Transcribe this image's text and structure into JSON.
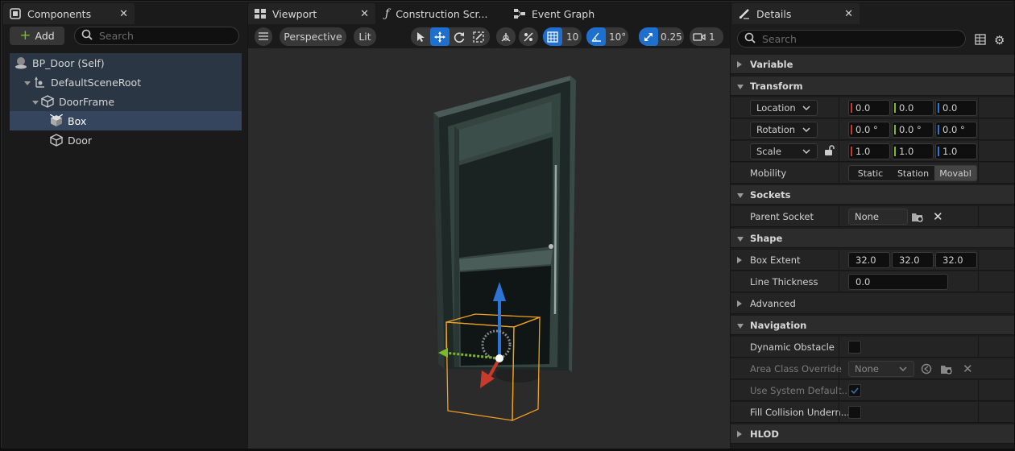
{
  "components_panel": {
    "tab_label": "Components",
    "add_label": "Add",
    "search_placeholder": "Search",
    "tree": [
      {
        "label": "BP_Door (Self)",
        "icon": "actor-icon"
      },
      {
        "label": "DefaultSceneRoot",
        "icon": "scene-root-icon"
      },
      {
        "label": "DoorFrame",
        "icon": "static-mesh-icon"
      },
      {
        "label": "Box",
        "icon": "box-collision-icon",
        "selected": true
      },
      {
        "label": "Door",
        "icon": "static-mesh-icon"
      }
    ]
  },
  "viewport": {
    "tabs": [
      {
        "label": "Viewport",
        "icon": "viewport-icon"
      },
      {
        "label": "Construction Scr...",
        "icon": "function-icon"
      },
      {
        "label": "Event Graph",
        "icon": "graph-icon"
      }
    ],
    "toolbar": {
      "perspective_label": "Perspective",
      "lit_label": "Lit",
      "grid_snap": "10",
      "rotation_snap": "10°",
      "scale_snap": "0.25",
      "camera_speed": "1"
    }
  },
  "details": {
    "tab_label": "Details",
    "search_placeholder": "Search",
    "sections": {
      "variable": "Variable",
      "transform": "Transform",
      "sockets": "Sockets",
      "shape": "Shape",
      "advanced": "Advanced",
      "navigation": "Navigation",
      "hlod": "HLOD"
    },
    "transform": {
      "location": {
        "label": "Location",
        "x": "0.0",
        "y": "0.0",
        "z": "0.0"
      },
      "rotation": {
        "label": "Rotation",
        "x": "0.0 °",
        "y": "0.0 °",
        "z": "0.0 °"
      },
      "scale": {
        "label": "Scale",
        "x": "1.0",
        "y": "1.0",
        "z": "1.0"
      },
      "mobility": {
        "label": "Mobility",
        "options": [
          "Static",
          "Station",
          "Movabl"
        ],
        "selected": "Movabl"
      }
    },
    "sockets": {
      "parent_socket_label": "Parent Socket",
      "parent_socket_value": "None"
    },
    "shape": {
      "box_extent_label": "Box Extent",
      "box_extent": [
        "32.0",
        "32.0",
        "32.0"
      ],
      "line_thickness_label": "Line Thickness",
      "line_thickness": "0.0"
    },
    "navigation": {
      "dynamic_obstacle_label": "Dynamic Obstacle",
      "area_class_label": "Area Class Override",
      "area_class_value": "None",
      "use_system_default_label": "Use System Default...",
      "fill_collision_label": "Fill Collision Undern..."
    }
  },
  "colors": {
    "accent": "#1f6fce",
    "axis_x": "#c83a2a",
    "axis_y": "#7fb82a",
    "axis_z": "#2e74d6",
    "selection": "#f0a01e"
  }
}
